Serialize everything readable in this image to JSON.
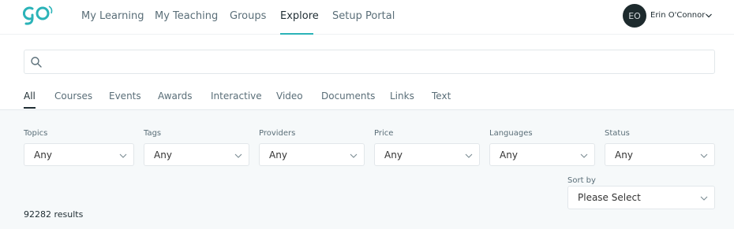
{
  "brand": {
    "logo_text": "go",
    "accent_color": "#2bb3b8"
  },
  "nav": {
    "items": [
      {
        "label": "My Learning"
      },
      {
        "label": "My Teaching"
      },
      {
        "label": "Groups"
      },
      {
        "label": "Explore",
        "active": true
      },
      {
        "label": "Setup Portal"
      }
    ]
  },
  "user": {
    "initials": "EO",
    "name": "Erin O'Connor",
    "menu_icon": "chevron-down-icon"
  },
  "search": {
    "icon": "search-icon",
    "value": "",
    "placeholder": ""
  },
  "tabs": [
    {
      "label": "All",
      "active": true
    },
    {
      "label": "Courses"
    },
    {
      "label": "Events"
    },
    {
      "label": "Awards"
    },
    {
      "label": "Interactive"
    },
    {
      "label": "Video"
    },
    {
      "label": "Documents"
    },
    {
      "label": "Links"
    },
    {
      "label": "Text"
    }
  ],
  "filters": [
    {
      "label": "Topics",
      "value": "Any"
    },
    {
      "label": "Tags",
      "value": "Any"
    },
    {
      "label": "Providers",
      "value": "Any"
    },
    {
      "label": "Price",
      "value": "Any"
    },
    {
      "label": "Languages",
      "value": "Any"
    },
    {
      "label": "Status",
      "value": "Any"
    }
  ],
  "sort": {
    "label": "Sort by",
    "value": "Please Select"
  },
  "results": {
    "text": "92282 results"
  }
}
